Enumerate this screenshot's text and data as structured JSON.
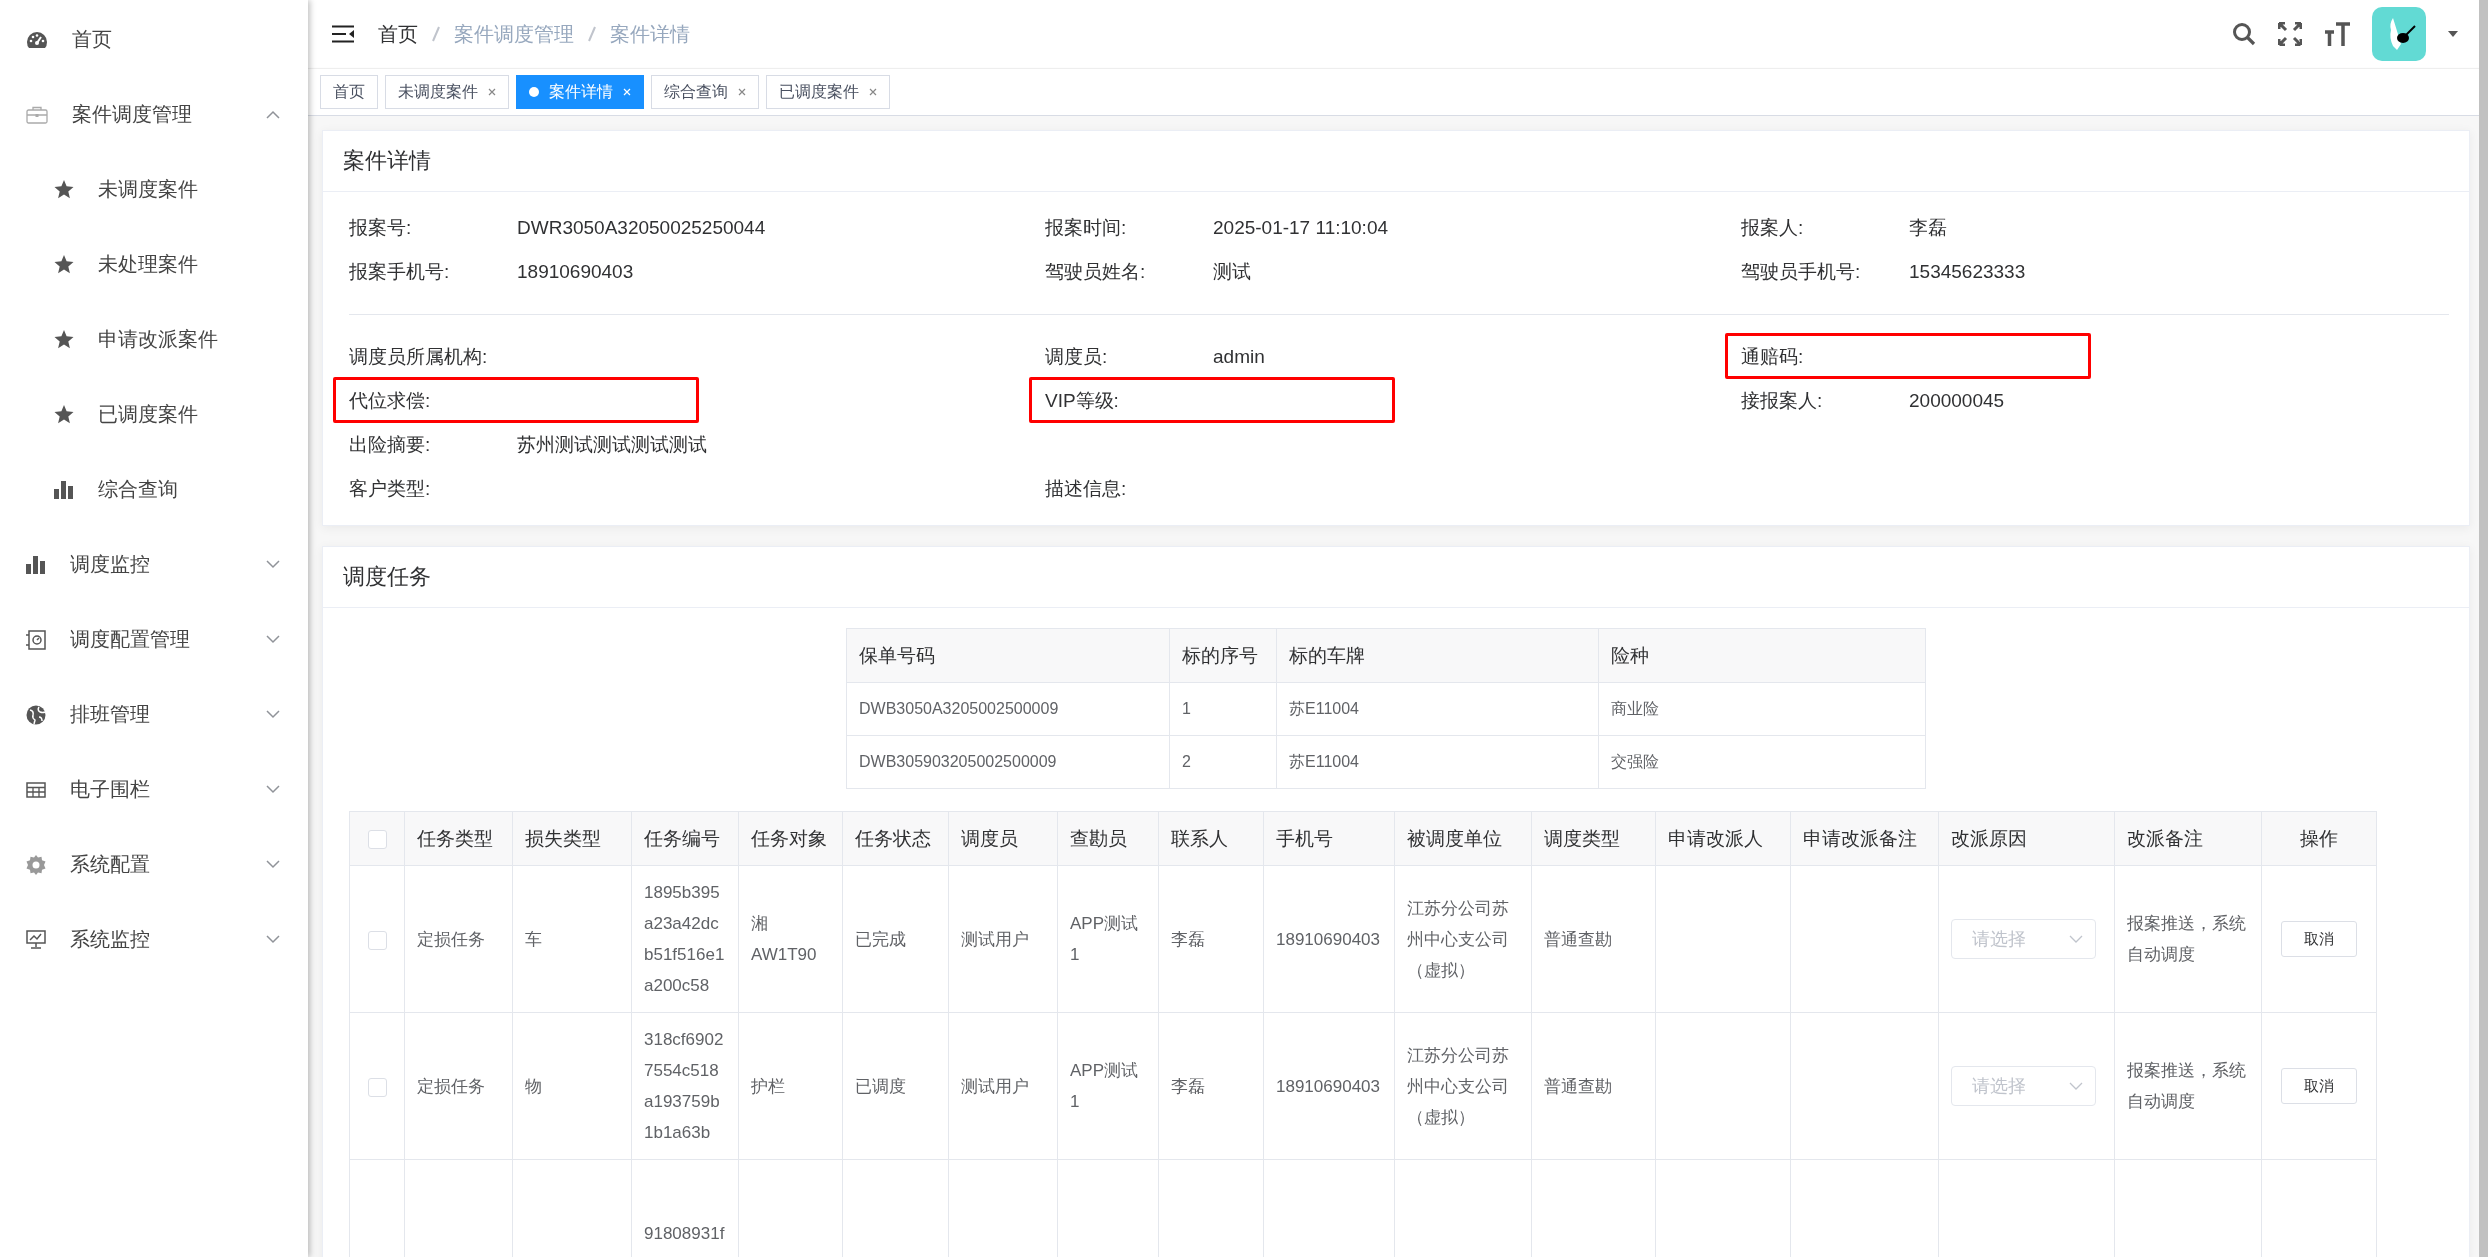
{
  "sidebar": {
    "items": [
      {
        "label": "首页"
      },
      {
        "label": "案件调度管理",
        "expanded": true,
        "children": [
          {
            "label": "未调度案件"
          },
          {
            "label": "未处理案件"
          },
          {
            "label": "申请改派案件"
          },
          {
            "label": "已调度案件"
          },
          {
            "label": "综合查询"
          }
        ]
      },
      {
        "label": "调度监控",
        "expanded": false
      },
      {
        "label": "调度配置管理",
        "expanded": false
      },
      {
        "label": "排班管理",
        "expanded": false
      },
      {
        "label": "电子围栏",
        "expanded": false
      },
      {
        "label": "系统配置",
        "expanded": false
      },
      {
        "label": "系统监控",
        "expanded": false
      }
    ]
  },
  "breadcrumb": [
    "首页",
    "案件调度管理",
    "案件详情"
  ],
  "tabs": [
    {
      "label": "首页",
      "selected": false,
      "closable": false
    },
    {
      "label": "未调度案件",
      "selected": false,
      "closable": true
    },
    {
      "label": "案件详情",
      "selected": true,
      "closable": true
    },
    {
      "label": "综合查询",
      "selected": false,
      "closable": true
    },
    {
      "label": "已调度案件",
      "selected": false,
      "closable": true
    }
  ],
  "details": {
    "title": "案件详情",
    "groups": [
      [
        [
          {
            "label": "报案号:",
            "value": "DWR3050A32050025250044",
            "highlighted": false
          },
          {
            "label": "报案时间:",
            "value": "2025-01-17 11:10:04",
            "highlighted": false
          },
          {
            "label": "报案人:",
            "value": "李磊",
            "highlighted": false
          }
        ],
        [
          {
            "label": "报案手机号:",
            "value": "18910690403",
            "highlighted": false
          },
          {
            "label": "驾驶员姓名:",
            "value": "测试",
            "highlighted": false
          },
          {
            "label": "驾驶员手机号:",
            "value": "15345623333",
            "highlighted": false
          }
        ]
      ],
      [
        [
          {
            "label": "调度员所属机构:",
            "highlighted": false
          },
          {
            "label": "调度员:",
            "value": "admin",
            "highlighted": false
          },
          {
            "label": "通赔码:",
            "highlighted": true
          }
        ],
        [
          {
            "label": "代位求偿:",
            "highlighted": true
          },
          {
            "label": "VIP等级:",
            "highlighted": true
          },
          {
            "label": "接报案人:",
            "value": "200000045",
            "highlighted": false
          }
        ],
        [
          {
            "label": "出险摘要:",
            "value": "苏州测试测试测试测试",
            "highlighted": false
          }
        ],
        [
          {
            "label": "客户类型:",
            "highlighted": false
          },
          {
            "label": "描述信息:",
            "highlighted": false
          }
        ]
      ]
    ]
  },
  "tasks": {
    "title": "调度任务",
    "policies": {
      "columns": [
        "保单号码",
        "标的序号",
        "标的车牌",
        "险种"
      ],
      "rows": [
        [
          "DWB3050A3205002500009",
          "1",
          "苏E11004",
          "商业险"
        ],
        [
          "DWB305903205002500009",
          "2",
          "苏E11004",
          "交强险"
        ]
      ]
    },
    "table": {
      "select_all_checked": false,
      "columns": [
        "任务类型",
        "损失类型",
        "任务编号",
        "任务对象",
        "任务状态",
        "调度员",
        "查勘员",
        "联系人",
        "手机号",
        "被调度单位",
        "调度类型",
        "申请改派人",
        "申请改派备注",
        "改派原因",
        "改派备注",
        "操作"
      ],
      "rows": [
        {
          "checked": false,
          "cells": [
            "定损任务",
            "车",
            "1895b395a23a42dcb51f516e1a200c58",
            "湘AW1T90",
            "已完成",
            "测试用户",
            "APP测试1",
            "李磊",
            "18910690403",
            "江苏分公司苏州中心支公司（虚拟）",
            "普通查勘",
            "",
            "",
            "",
            "报案推送，系统自动调度",
            ""
          ],
          "reason_placeholder": "请选择",
          "action": "取消"
        },
        {
          "checked": false,
          "cells": [
            "定损任务",
            "物",
            "318cf69027554c518a193759b1b1a63b",
            "护栏",
            "已调度",
            "测试用户",
            "APP测试1",
            "李磊",
            "18910690403",
            "江苏分公司苏州中心支公司（虚拟）",
            "普通查勘",
            "",
            "",
            "",
            "报案推送，系统自动调度",
            ""
          ],
          "reason_placeholder": "请选择",
          "action": "取消"
        },
        {
          "cells": [
            "",
            "",
            "91808931f",
            "",
            "",
            "",
            "",
            "",
            "",
            "",
            "",
            "",
            "",
            "",
            "",
            ""
          ]
        }
      ]
    }
  }
}
